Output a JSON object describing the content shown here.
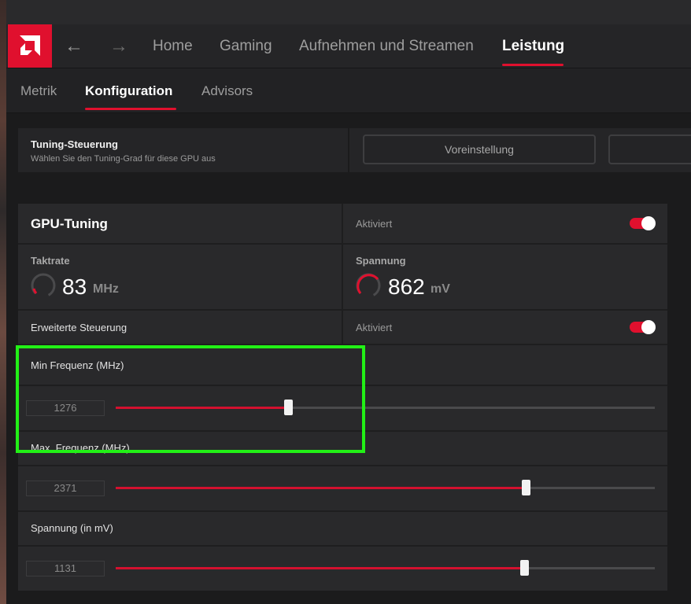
{
  "nav": {
    "back_icon": "arrow-left-icon",
    "forward_icon": "arrow-right-icon",
    "items": [
      {
        "label": "Home"
      },
      {
        "label": "Gaming"
      },
      {
        "label": "Aufnehmen und Streamen"
      },
      {
        "label": "Leistung"
      }
    ],
    "active": "Leistung"
  },
  "subnav": {
    "items": [
      {
        "label": "Metrik"
      },
      {
        "label": "Konfiguration"
      },
      {
        "label": "Advisors"
      }
    ],
    "active": "Konfiguration"
  },
  "tuning_control": {
    "title": "Tuning-Steuerung",
    "description": "Wählen Sie den Tuning-Grad für diese GPU aus",
    "preset_button": "Voreinstellung"
  },
  "gpu_tuning": {
    "title": "GPU-Tuning",
    "status": "Aktiviert",
    "enabled": true,
    "clock": {
      "label": "Taktrate",
      "value": "83",
      "unit": "MHz"
    },
    "voltage": {
      "label": "Spannung",
      "value": "862",
      "unit": "mV"
    },
    "advanced": {
      "label": "Erweiterte Steuerung",
      "status": "Aktiviert",
      "enabled": true
    },
    "sliders": [
      {
        "label": "Min Frequenz (MHz)",
        "value": "1276",
        "fill_fraction": 0.32
      },
      {
        "label": "Max. Frequenz (MHz)",
        "value": "2371",
        "fill_fraction": 0.76
      },
      {
        "label": "Spannung (in mV)",
        "value": "1131",
        "fill_fraction": 0.757
      }
    ]
  },
  "colors": {
    "accent": "#e0102e",
    "highlight": "#22f016"
  }
}
